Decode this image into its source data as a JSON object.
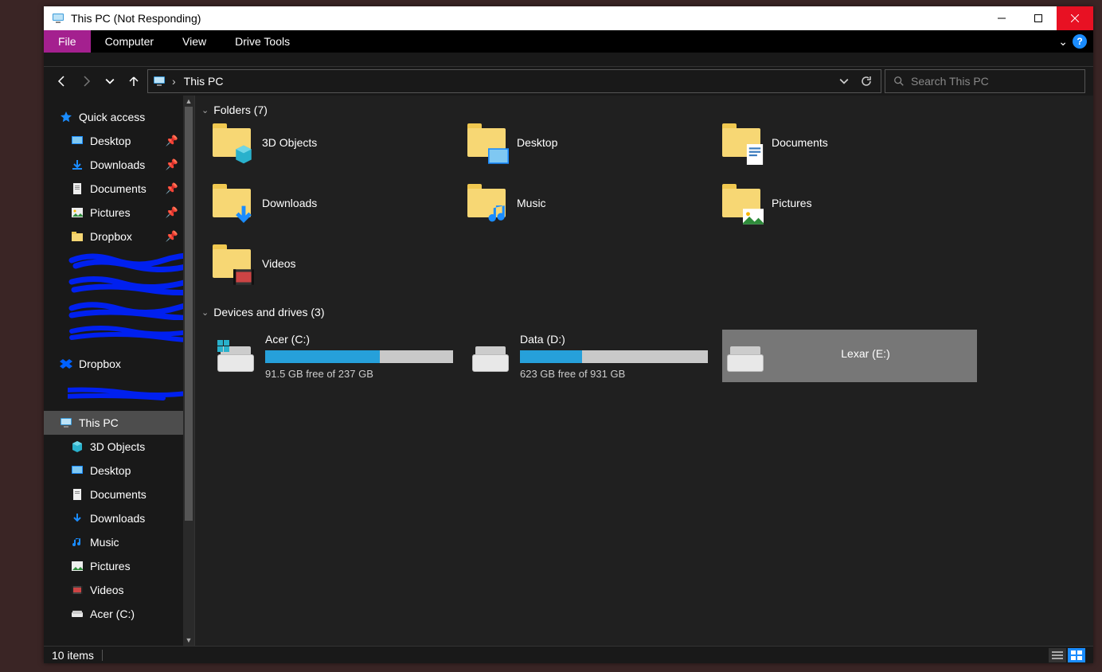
{
  "window": {
    "title": "This PC (Not Responding)"
  },
  "menubar": {
    "file": "File",
    "computer": "Computer",
    "view": "View",
    "drive_tools": "Drive Tools"
  },
  "address": {
    "location": "This PC"
  },
  "search": {
    "placeholder": "Search This PC"
  },
  "sidebar": {
    "quick_access": "Quick access",
    "qa_items": [
      {
        "label": "Desktop",
        "icon": "desktop",
        "pinned": true
      },
      {
        "label": "Downloads",
        "icon": "downloads",
        "pinned": true
      },
      {
        "label": "Documents",
        "icon": "documents",
        "pinned": true
      },
      {
        "label": "Pictures",
        "icon": "pictures",
        "pinned": true
      },
      {
        "label": "Dropbox",
        "icon": "dropbox",
        "pinned": true
      }
    ],
    "dropbox": "Dropbox",
    "this_pc": "This PC",
    "pc_items": [
      {
        "label": "3D Objects",
        "icon": "3d"
      },
      {
        "label": "Desktop",
        "icon": "desktop"
      },
      {
        "label": "Documents",
        "icon": "documents"
      },
      {
        "label": "Downloads",
        "icon": "downloads"
      },
      {
        "label": "Music",
        "icon": "music"
      },
      {
        "label": "Pictures",
        "icon": "pictures"
      },
      {
        "label": "Videos",
        "icon": "videos"
      },
      {
        "label": "Acer (C:)",
        "icon": "drive"
      }
    ]
  },
  "main": {
    "folders_header": "Folders (7)",
    "folders": [
      {
        "label": "3D Objects",
        "overlay": "3d"
      },
      {
        "label": "Desktop",
        "overlay": "desktop"
      },
      {
        "label": "Documents",
        "overlay": "documents"
      },
      {
        "label": "Downloads",
        "overlay": "downloads"
      },
      {
        "label": "Music",
        "overlay": "music"
      },
      {
        "label": "Pictures",
        "overlay": "pictures"
      },
      {
        "label": "Videos",
        "overlay": "videos"
      }
    ],
    "drives_header": "Devices and drives (3)",
    "drives": [
      {
        "name": "Acer (C:)",
        "free_text": "91.5 GB free of 237 GB",
        "used_pct": 61,
        "os": true,
        "selected": false
      },
      {
        "name": "Data (D:)",
        "free_text": "623 GB free of 931 GB",
        "used_pct": 33,
        "os": false,
        "selected": false
      },
      {
        "name": "Lexar (E:)",
        "free_text": "",
        "used_pct": null,
        "os": false,
        "selected": true
      }
    ]
  },
  "statusbar": {
    "count": "10 items"
  }
}
